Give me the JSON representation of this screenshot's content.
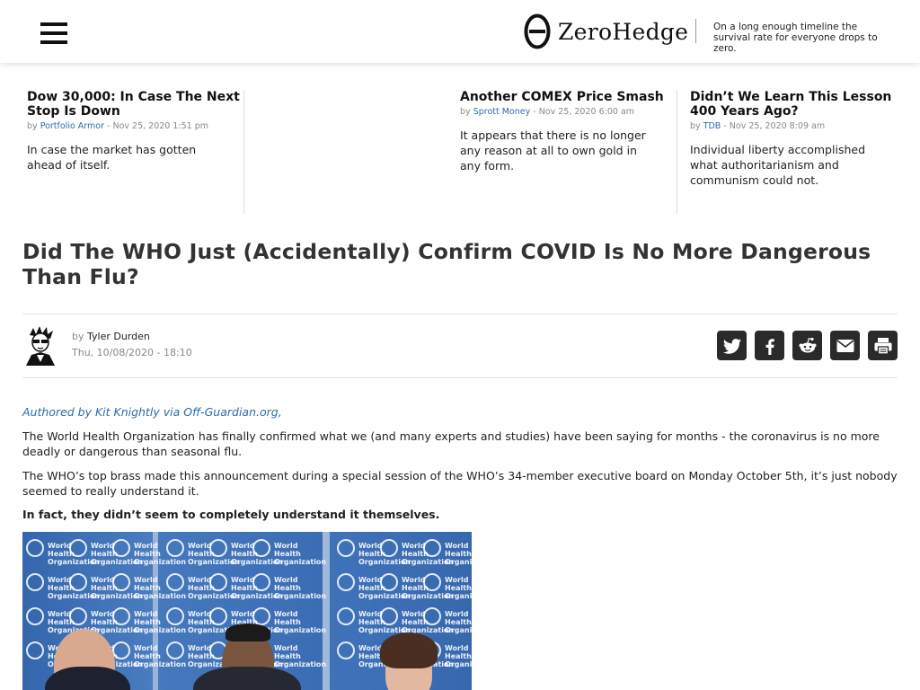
{
  "header": {
    "logo_text": "ZeroHedge",
    "tagline": "On a long enough timeline the survival rate for everyone drops to zero."
  },
  "teasers": [
    {
      "title": "Dow 30,000: In Case The Next Stop Is Down",
      "by": "by",
      "author": "Portfolio Armor",
      "date": " - Nov 25, 2020 1:51 pm",
      "excerpt": "In case the market has gotten ahead of itself."
    },
    {
      "title": "Another COMEX Price Smash",
      "by": "by",
      "author": "Sprott Money",
      "date": " - Nov 25, 2020 6:00 am",
      "excerpt": "It appears that there is no longer any reason at all to own gold in any form."
    },
    {
      "title": "Didn’t We Learn This Lesson 400 Years Ago?",
      "by": "by",
      "author": "TDB",
      "date": " - Nov 25, 2020 8:09 am",
      "excerpt": "Individual liberty accomplished what authoritarianism and communism could not."
    }
  ],
  "article": {
    "title": "Did The WHO Just (Accidentally) Confirm COVID Is No More Dangerous Than Flu?",
    "by": "by",
    "author": "Tyler Durden",
    "datetime": "Thu, 10/08/2020 - 18:10",
    "source_link": "Authored by Kit Knightly via Off-Guardian.org,",
    "paragraphs": [
      "The World Health Organization has finally confirmed what we (and many experts and studies) have been saying for months - the coronavirus is no more deadly or dangerous than seasonal flu.",
      "The WHO’s top brass made this announcement during a special session of the WHO’s 34-member executive board on Monday October 5th, it’s just nobody seemed to really understand it."
    ],
    "bold_paragraph": "In fact, they didn’t seem to completely understand it themselves.",
    "photo_backdrop_text": "World Health Organization"
  },
  "share_icons": [
    "twitter-icon",
    "facebook-icon",
    "reddit-icon",
    "email-icon",
    "print-icon"
  ],
  "colors": {
    "link": "#2a6cb0",
    "share_bg": "#2a2a2a",
    "photo_bg": "#3c6fb3"
  }
}
